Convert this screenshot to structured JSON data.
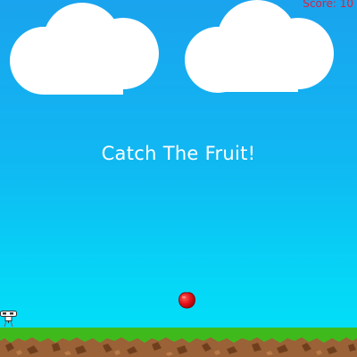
{
  "hud": {
    "score_label": "Score: 10"
  },
  "game": {
    "title": "Catch The Fruit!",
    "fruit": "apple",
    "player": "robot-catcher"
  },
  "colors": {
    "sky_top": "#1aa3ee",
    "sky_bottom": "#00e3f8",
    "cloud": "#ffffff",
    "score_text": "#e0203c",
    "title_text": "#ffffff",
    "fruit": "#e3121a",
    "grass": "#3fba1c",
    "dirt": "#9a6236"
  }
}
